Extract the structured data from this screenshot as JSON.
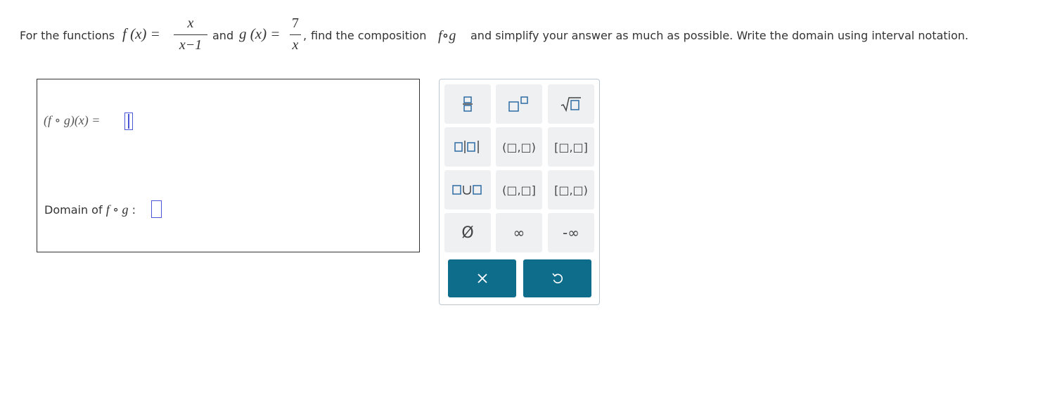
{
  "problem": {
    "prefix": "For the functions",
    "f_lhs": "f (x) =",
    "f_num": "x",
    "f_den": "x−1",
    "and": "and",
    "g_lhs": "g (x) =",
    "g_num": "7",
    "g_den": "x",
    "comma": ",",
    "suffix_start": "find the composition",
    "fog": "f∘g",
    "suffix_end": "and simplify your answer as much as possible. Write the domain using interval notation."
  },
  "answer": {
    "composition_expr": "(f ∘ g)(x) =",
    "composition_value": "",
    "domain_label_start": "Domain of",
    "domain_label_fog": "f ∘ g",
    "domain_label_colon": ":",
    "domain_value": ""
  },
  "keypad": {
    "keys": {
      "fraction": "fraction-icon",
      "exponent": "exponent-icon",
      "sqrt": "sqrt-icon",
      "abs": "abs-icon",
      "open_interval": "(□,□)",
      "closed_interval": "[□,□]",
      "union": "union-icon",
      "left_open": "(□,□]",
      "right_open": "[□,□)",
      "empty_set": "Ø",
      "infinity": "∞",
      "neg_infinity": "-∞"
    },
    "clear_icon": "close-icon",
    "undo_icon": "undo-icon",
    "colors": {
      "action_bg": "#0e6d8b",
      "key_bg": "#eef0f2",
      "box_blue": "#2d6aa3",
      "focus": "#4b55d6"
    }
  }
}
